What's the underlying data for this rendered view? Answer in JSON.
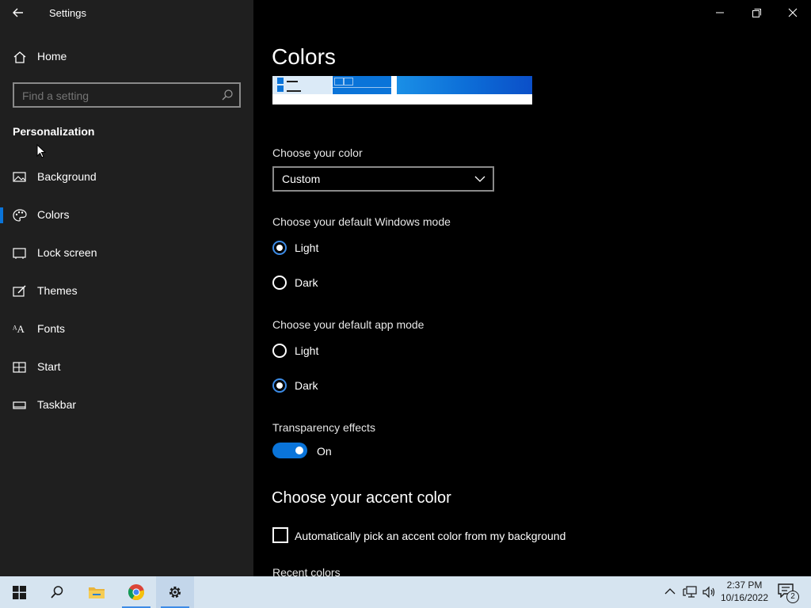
{
  "window": {
    "title": "Settings"
  },
  "sidebar": {
    "home_label": "Home",
    "search_placeholder": "Find a setting",
    "section_title": "Personalization",
    "items": [
      {
        "label": "Background",
        "icon": "image-icon"
      },
      {
        "label": "Colors",
        "icon": "palette-icon",
        "selected": true
      },
      {
        "label": "Lock screen",
        "icon": "lock-screen-icon"
      },
      {
        "label": "Themes",
        "icon": "themes-icon"
      },
      {
        "label": "Fonts",
        "icon": "fonts-icon"
      },
      {
        "label": "Start",
        "icon": "start-icon"
      },
      {
        "label": "Taskbar",
        "icon": "taskbar-icon"
      }
    ]
  },
  "main": {
    "title": "Colors",
    "choose_color": {
      "label": "Choose your color",
      "value": "Custom"
    },
    "windows_mode": {
      "label": "Choose your default Windows mode",
      "options": [
        "Light",
        "Dark"
      ],
      "selected": "Light"
    },
    "app_mode": {
      "label": "Choose your default app mode",
      "options": [
        "Light",
        "Dark"
      ],
      "selected": "Dark"
    },
    "transparency": {
      "label": "Transparency effects",
      "state": "On"
    },
    "accent": {
      "heading": "Choose your accent color",
      "auto_pick_label": "Automatically pick an accent color from my background",
      "recent_label": "Recent colors"
    }
  },
  "taskbar": {
    "time": "2:37 PM",
    "date": "10/16/2022",
    "notification_count": "2",
    "apps": [
      "start-icon",
      "search-icon",
      "file-explorer-icon",
      "chrome-icon",
      "settings-gear-icon"
    ]
  },
  "colors": {
    "accent": "#0a74d9",
    "sidebar_bg": "#1f1f1f",
    "main_bg": "#000000",
    "taskbar_bg": "#d6e4f0"
  }
}
